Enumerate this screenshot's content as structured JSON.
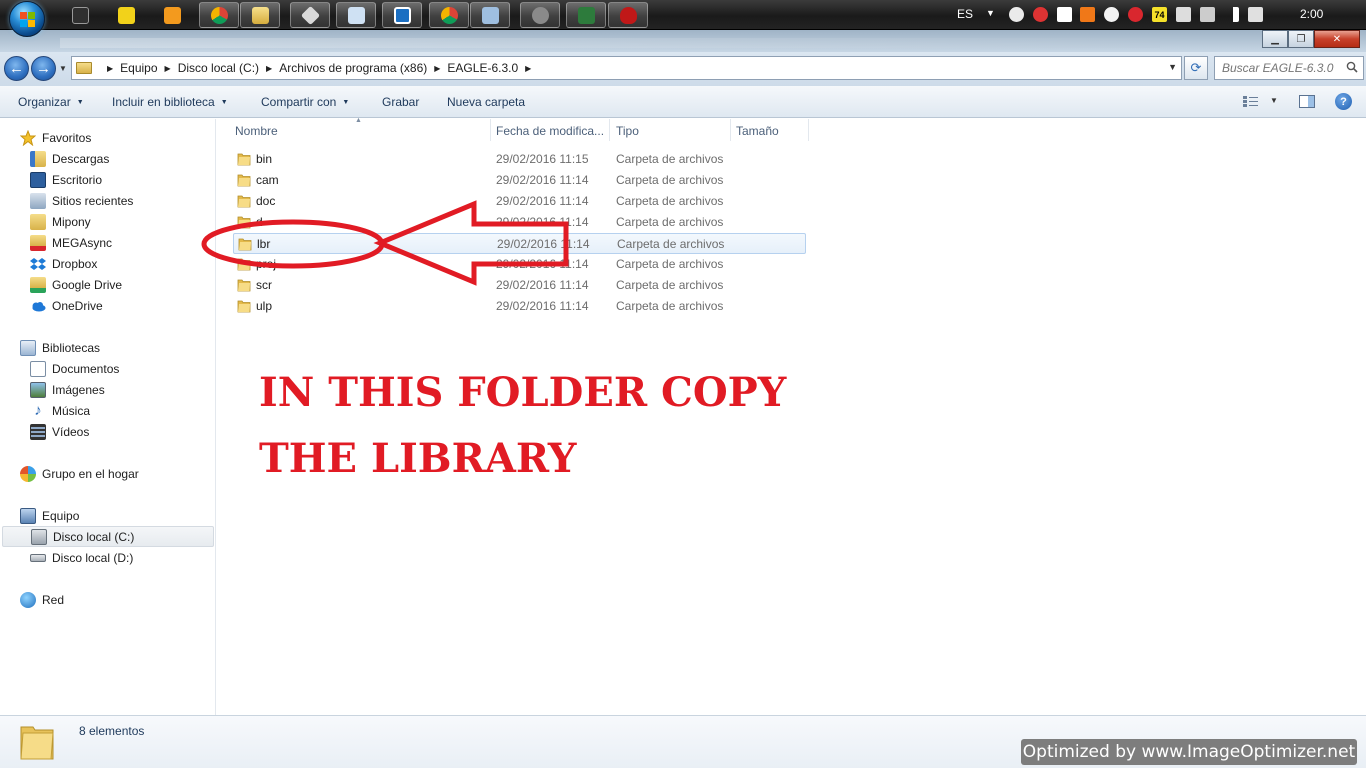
{
  "taskbar": {
    "buttons": [
      "start-orb",
      "minecraft",
      "norton",
      "media-player",
      "chrome",
      "explorer",
      "git",
      "notepad",
      "xmind",
      "chrome",
      "control-panel",
      "gimp",
      "arduino",
      "app-red"
    ],
    "tray": {
      "language": "ES",
      "clock": "2:00",
      "badge_number": "74"
    }
  },
  "address": {
    "crumbs": [
      "Equipo",
      "Disco local (C:)",
      "Archivos de programa (x86)",
      "EAGLE-6.3.0"
    ],
    "search_placeholder": "Buscar EAGLE-6.3.0"
  },
  "toolbar": {
    "organize": "Organizar",
    "include_library": "Incluir en biblioteca",
    "share_with": "Compartir con",
    "burn": "Grabar",
    "new_folder": "Nueva carpeta"
  },
  "nav": {
    "favorites": {
      "label": "Favoritos",
      "items": [
        "Descargas",
        "Escritorio",
        "Sitios recientes",
        "Mipony",
        "MEGAsync",
        "Dropbox",
        "Google Drive",
        "OneDrive"
      ]
    },
    "libraries": {
      "label": "Bibliotecas",
      "items": [
        "Documentos",
        "Imágenes",
        "Música",
        "Vídeos"
      ]
    },
    "homegroup": "Grupo en el hogar",
    "computer": {
      "label": "Equipo",
      "items": [
        "Disco local (C:)",
        "Disco local (D:)"
      ]
    },
    "network": "Red"
  },
  "columns": {
    "name": "Nombre",
    "date": "Fecha de modifica...",
    "type": "Tipo",
    "size": "Tamaño"
  },
  "files": [
    {
      "name": "bin",
      "date": "29/02/2016 11:15",
      "type": "Carpeta de archivos"
    },
    {
      "name": "cam",
      "date": "29/02/2016 11:14",
      "type": "Carpeta de archivos"
    },
    {
      "name": "doc",
      "date": "29/02/2016 11:14",
      "type": "Carpeta de archivos"
    },
    {
      "name": "d",
      "date": "29/02/2016 11:14",
      "type": "Carpeta de archivos"
    },
    {
      "name": "lbr",
      "date": "29/02/2016 11:14",
      "type": "Carpeta de archivos"
    },
    {
      "name": "proj",
      "date": "29/02/2016 11:14",
      "type": "Carpeta de archivos"
    },
    {
      "name": "scr",
      "date": "29/02/2016 11:14",
      "type": "Carpeta de archivos"
    },
    {
      "name": "ulp",
      "date": "29/02/2016 11:14",
      "type": "Carpeta de archivos"
    }
  ],
  "selected_file": "lbr",
  "annotation": {
    "line1": "IN THIS FOLDER COPY",
    "line2": "THE LIBRARY",
    "color": "#e11b24"
  },
  "status": {
    "count": "8 elementos"
  },
  "watermark": "Optimized by www.ImageOptimizer.net"
}
